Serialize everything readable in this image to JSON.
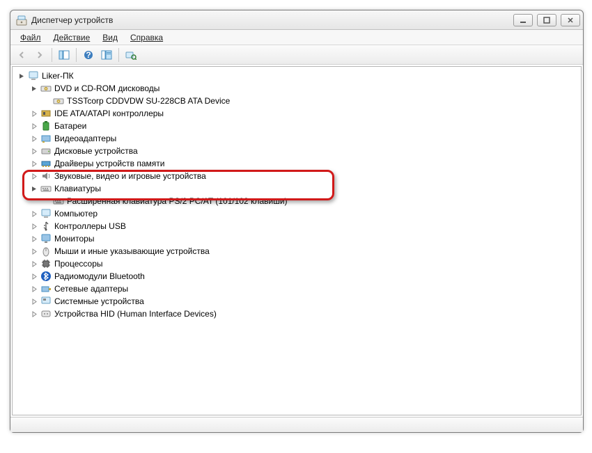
{
  "window": {
    "title": "Диспетчер устройств"
  },
  "menu": {
    "file": "Файл",
    "action": "Действие",
    "view": "Вид",
    "help": "Справка"
  },
  "tree": {
    "root": "Liker-ПК",
    "dvd": {
      "label": "DVD и CD-ROM дисководы",
      "child": "TSSTcorp CDDVDW SU-228CB ATA Device"
    },
    "ide": "IDE ATA/ATAPI контроллеры",
    "battery": "Батареи",
    "video": "Видеоадаптеры",
    "disk": "Дисковые устройства",
    "memdrv": "Драйверы устройств памяти",
    "audio": "Звуковые, видео и игровые устройства",
    "keyboard": {
      "label": "Клавиатуры",
      "child": "Расширенная клавиатура PS/2 PC/AT (101/102 клавиши)"
    },
    "computer": "Компьютер",
    "usb": "Контроллеры USB",
    "monitor": "Мониторы",
    "mouse": "Мыши и иные указывающие устройства",
    "cpu": "Процессоры",
    "bt": "Радиомодули Bluetooth",
    "net": "Сетевые адаптеры",
    "sys": "Системные устройства",
    "hid": "Устройства HID (Human Interface Devices)"
  }
}
